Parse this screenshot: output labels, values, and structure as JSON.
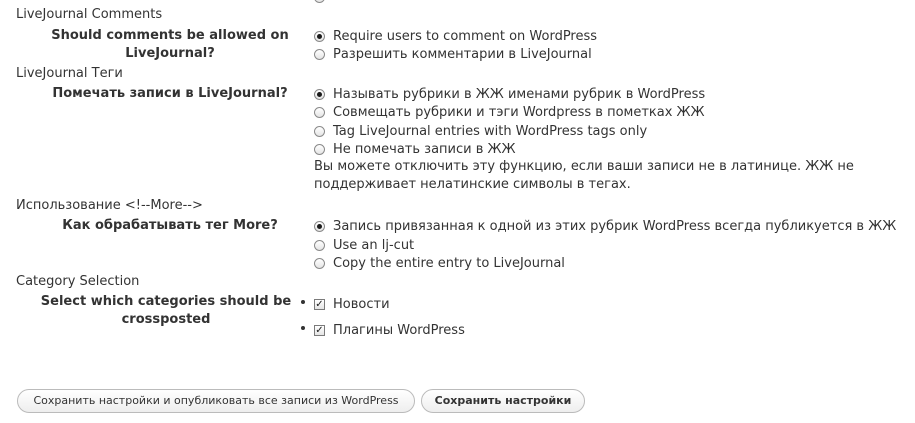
{
  "sections": {
    "lj_comments": {
      "heading": "LiveJournal Comments",
      "question": "Should comments be allowed on LiveJournal?",
      "options": [
        {
          "label": "Require users to comment on WordPress",
          "checked": true
        },
        {
          "label": "Разрешить комментарии в LiveJournal",
          "checked": false
        }
      ]
    },
    "lj_tags": {
      "heading": "LiveJournal Теги",
      "question": "Помечать записи в LiveJournal?",
      "options": [
        {
          "label": "Называть рубрики в ЖЖ именами рубрик в WordPress",
          "checked": true
        },
        {
          "label": "Совмещать рубрики и тэги Wordpress в пометках ЖЖ",
          "checked": false
        },
        {
          "label": "Tag LiveJournal entries with WordPress tags only",
          "checked": false
        },
        {
          "label": "Не помечать записи в ЖЖ",
          "checked": false
        }
      ],
      "note": "Вы можете отключить эту функцию, если ваши записи не в латинице. ЖЖ не поддерживает нелатинские символы в тегах."
    },
    "more_tag": {
      "heading": "Использование <!--More-->",
      "question": "Как обрабатывать тег More?",
      "options": [
        {
          "label": "Запись привязанная к одной из этих рубрик WordPress всегда публикуется в ЖЖ",
          "checked": true
        },
        {
          "label": "Use an lj-cut",
          "checked": false
        },
        {
          "label": "Copy the entire entry to LiveJournal",
          "checked": false
        }
      ]
    },
    "categories": {
      "heading": "Category Selection",
      "question": "Select which categories should be crossposted",
      "items": [
        {
          "label": "Новости",
          "checked": true
        },
        {
          "label": "Плагины WordPress",
          "checked": true
        }
      ]
    }
  },
  "buttons": {
    "save_publish": "Сохранить настройки и опубликовать все записи из WordPress",
    "save": "Сохранить настройки"
  },
  "colors": {
    "text": "#333333",
    "button_border": "#bbbbbb",
    "background": "#ffffff"
  }
}
